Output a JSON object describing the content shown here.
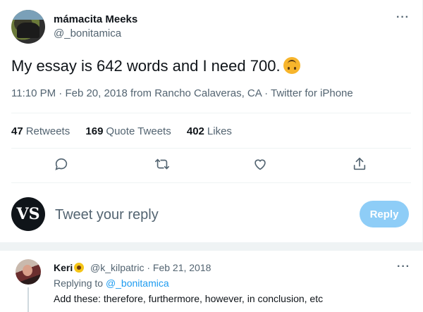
{
  "tweet": {
    "display_name": "mámacita Meeks",
    "handle": "@_bonitamica",
    "text": "My essay is 642 words and I need 700.",
    "emoji": "upside-down-face",
    "time": "11:10 PM",
    "date": "Feb 20, 2018",
    "location_prefix": "from",
    "location": "Rancho Calaveras, CA",
    "source": "Twitter for iPhone",
    "more_label": "···"
  },
  "stats": {
    "retweets_count": "47",
    "retweets_label": "Retweets",
    "quotes_count": "169",
    "quotes_label": "Quote Tweets",
    "likes_count": "402",
    "likes_label": "Likes"
  },
  "actions": {
    "reply_icon": "comment-icon",
    "retweet_icon": "retweet-icon",
    "like_icon": "heart-icon",
    "share_icon": "share-icon"
  },
  "composer": {
    "avatar_text": "VS",
    "placeholder": "Tweet your reply",
    "reply_button": "Reply",
    "button_color": "#8ecdf7"
  },
  "reply": {
    "display_name": "Keri",
    "emoji": "sunflower",
    "handle": "@k_kilpatric",
    "separator": "·",
    "date": "Feb 21, 2018",
    "replying_prefix": "Replying to",
    "replying_to": "@_bonitamica",
    "text": "Add these: therefore, furthermore, however, in conclusion, etc",
    "more_label": "···"
  },
  "colors": {
    "accent": "#1d9bf0",
    "muted": "#536471",
    "text": "#0f1419"
  }
}
